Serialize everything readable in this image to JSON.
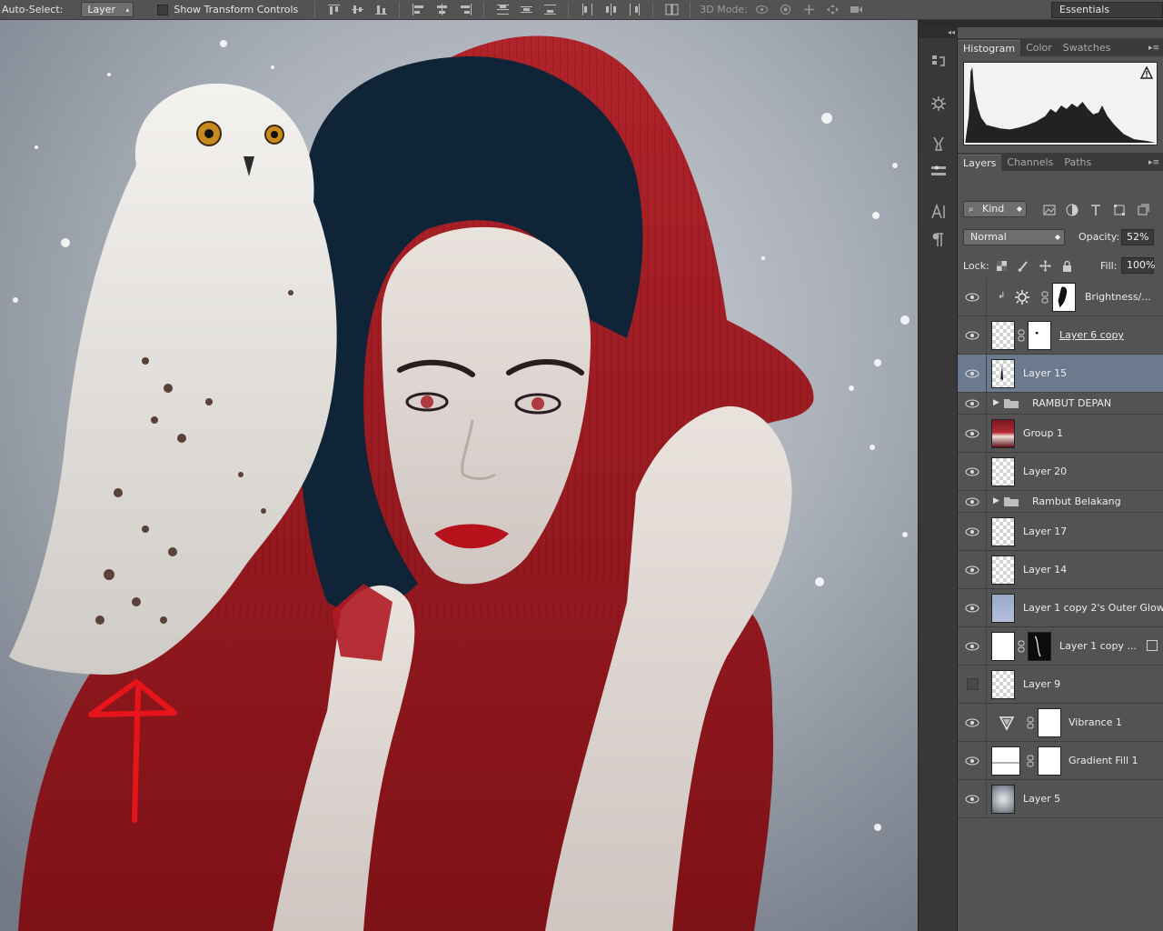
{
  "options_bar": {
    "auto_select_label": "Auto-Select:",
    "auto_select_value": "Layer",
    "show_transform_label": "Show Transform Controls",
    "mode_3d_label": "3D Mode:",
    "workspace": "Essentials"
  },
  "top_panel": {
    "tabs": [
      "Histogram",
      "Color",
      "Swatches"
    ],
    "active_tab": "Histogram"
  },
  "layers_panel": {
    "tabs": [
      "Layers",
      "Channels",
      "Paths"
    ],
    "active_tab": "Layers",
    "filter_kind": "Kind",
    "blend_mode": "Normal",
    "opacity_label": "Opacity:",
    "opacity_value": "52%",
    "lock_label": "Lock:",
    "fill_label": "Fill:",
    "fill_value": "100%",
    "layers": [
      {
        "name": "Brightness/...",
        "visible": true,
        "type": "adjustment-brightness",
        "clipped": true,
        "mask": "black-figure"
      },
      {
        "name": "Layer 6 copy",
        "visible": true,
        "type": "pixel",
        "mask": "white-dot",
        "underline": true
      },
      {
        "name": "Layer 15",
        "visible": true,
        "type": "pixel",
        "selected": true
      },
      {
        "name": "RAMBUT DEPAN",
        "visible": true,
        "type": "group"
      },
      {
        "name": "Group 1",
        "visible": true,
        "type": "photo"
      },
      {
        "name": "Layer 20",
        "visible": true,
        "type": "pixel"
      },
      {
        "name": "Rambut Belakang",
        "visible": true,
        "type": "group"
      },
      {
        "name": "Layer 17",
        "visible": true,
        "type": "pixel"
      },
      {
        "name": "Layer 14",
        "visible": true,
        "type": "pixel"
      },
      {
        "name": "Layer 1 copy 2's Outer Glow",
        "visible": true,
        "type": "glow"
      },
      {
        "name": "Layer 1 copy ...",
        "visible": true,
        "type": "pixel-white",
        "mask": "black"
      },
      {
        "name": "Layer 9",
        "visible": false,
        "type": "pixel"
      },
      {
        "name": "Vibrance 1",
        "visible": true,
        "type": "adjustment-vibrance",
        "mask": "white"
      },
      {
        "name": "Gradient Fill 1",
        "visible": true,
        "type": "gradient",
        "mask": "white"
      },
      {
        "name": "Layer 5",
        "visible": true,
        "type": "cloud"
      }
    ]
  },
  "colors": {
    "panel": "#535353",
    "selected_layer": "#6c7a8f",
    "cloak_red": "#a01c22",
    "arrow_red": "#e8141c",
    "hair": "#0f2436"
  }
}
